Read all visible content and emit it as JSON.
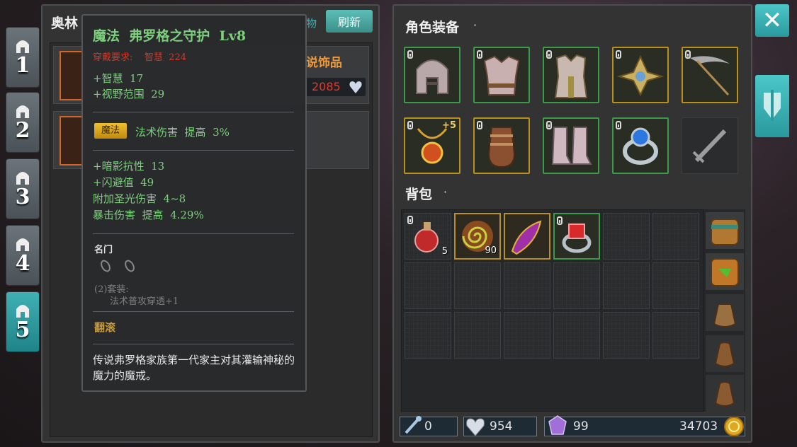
{
  "char_tabs": [
    {
      "number": "1"
    },
    {
      "number": "2"
    },
    {
      "number": "3"
    },
    {
      "number": "4"
    },
    {
      "number": "5"
    }
  ],
  "left_panel": {
    "title": "奥林",
    "refresh_label": "刷新",
    "side_text": "物",
    "item_name_partial": "说饰品",
    "price": "2085"
  },
  "tooltip": {
    "name": "魔法  弗罗格之守护  Lv8",
    "requirement": "穿戴要求:    智慧  224",
    "base_stats": [
      "+智慧  17",
      "+视野范围  29"
    ],
    "magic_tag": "魔法",
    "magic_effect": "法术伤害  提高  3%",
    "extra_stats": [
      "+暗影抗性  13",
      "+闪避值  49",
      "附加圣光伤害  4~8",
      "暴击伤害  提高  4.29%"
    ],
    "set_name": "名门",
    "set_bonus_title": "(2)套装:",
    "set_bonus_effect": "法术普攻穿透+1",
    "skill": "翻滚",
    "description": "传说弗罗格家族第一代家主对其灌输神秘的魔力的魔戒。"
  },
  "equipment": {
    "title": "角色装备",
    "ring_bonus": "+5"
  },
  "backpack": {
    "title": "背包",
    "items": [
      {
        "count": "5"
      },
      {
        "count": "90"
      },
      {
        "count": ""
      },
      {
        "count": ""
      }
    ]
  },
  "currency": {
    "keys": "0",
    "gems": "954",
    "crystals": "99",
    "gold": "34703"
  },
  "colors": {
    "accent": "#3fb0b4",
    "uncommon": "#3c9a4a",
    "rare": "#b8901d",
    "tooltip_green": "#7ed07e",
    "requirement_red": "#d03a2a"
  }
}
